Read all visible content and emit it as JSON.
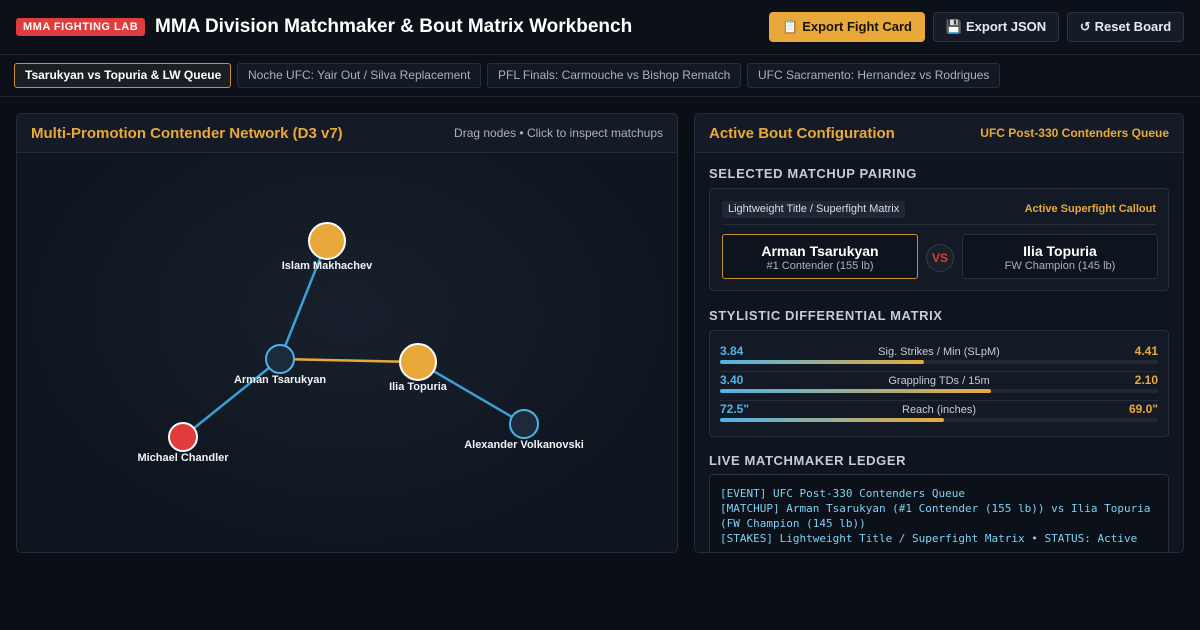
{
  "header": {
    "brand": "MMA FIGHTING LAB",
    "title": "MMA Division Matchmaker & Bout Matrix Workbench",
    "export_card_icon": "clipboard-icon",
    "export_card_glyph": "📋",
    "export_card": "Export Fight Card",
    "export_json_icon": "floppy-icon",
    "export_json_glyph": "💾",
    "export_json": "Export JSON",
    "reset_icon": "reset-icon",
    "reset_glyph": "↺",
    "reset": "Reset Board"
  },
  "tabs": [
    {
      "label": "Tsarukyan vs Topuria & LW Queue",
      "active": true
    },
    {
      "label": "Noche UFC: Yair Out / Silva Replacement",
      "active": false
    },
    {
      "label": "PFL Finals: Carmouche vs Bishop Rematch",
      "active": false
    },
    {
      "label": "UFC Sacramento: Hernandez vs Rodrigues",
      "active": false
    }
  ],
  "network": {
    "title": "Multi-Promotion Contender Network (D3 v7)",
    "hint": "Drag nodes • Click to inspect matchups",
    "nodes": [
      {
        "id": "makhachev",
        "label": "Islam Makhachev",
        "color": "#e8a93a",
        "stroke": "#ffffff",
        "big": true
      },
      {
        "id": "tsarukyan",
        "label": "Arman Tsarukyan",
        "color": "#1d2a3b",
        "stroke": "#4fb3e8",
        "big": false
      },
      {
        "id": "topuria",
        "label": "Ilia Topuria",
        "color": "#e8a93a",
        "stroke": "#ffffff",
        "big": true
      },
      {
        "id": "chandler",
        "label": "Michael Chandler",
        "color": "#e03c3c",
        "stroke": "#ffffff",
        "big": false
      },
      {
        "id": "volkanovski",
        "label": "Alexander Volkanovski",
        "color": "#1d2a3b",
        "stroke": "#4fb3e8",
        "big": false
      }
    ],
    "links": [
      {
        "source": "makhachev",
        "target": "tsarukyan",
        "color": "#3a9fd6"
      },
      {
        "source": "tsarukyan",
        "target": "topuria",
        "color": "#e8a93a"
      },
      {
        "source": "tsarukyan",
        "target": "chandler",
        "color": "#3a9fd6"
      },
      {
        "source": "topuria",
        "target": "volkanovski",
        "color": "#3a9fd6"
      }
    ]
  },
  "config": {
    "title": "Active Bout Configuration",
    "queue": "UFC Post-330 Contenders Queue",
    "pairing_heading": "Selected Matchup Pairing",
    "pairing_tag": "Lightweight Title / Superfight Matrix",
    "pairing_status": "Active Superfight Callout",
    "fighter_a": {
      "name": "Arman Tsarukyan",
      "sub": "#1 Contender (155 lb)"
    },
    "vs": "VS",
    "fighter_b": {
      "name": "Ilia Topuria",
      "sub": "FW Champion (145 lb)"
    },
    "matrix_heading": "Stylistic Differential Matrix",
    "stats": [
      {
        "a": "3.84",
        "label": "Sig. Strikes / Min (SLpM)",
        "b": "4.41",
        "fill": 0.465
      },
      {
        "a": "3.40",
        "label": "Grappling TDs / 15m",
        "b": "2.10",
        "fill": 0.618
      },
      {
        "a": "72.5\"",
        "label": "Reach (inches)",
        "b": "69.0\"",
        "fill": 0.512
      }
    ],
    "ledger_heading": "Live Matchmaker Ledger",
    "ledger": [
      "[EVENT] UFC Post-330 Contenders Queue",
      "[MATCHUP] Arman Tsarukyan (#1 Contender (155 lb)) vs Ilia Topuria",
      "(FW Champion (145 lb))",
      "[STAKES] Lightweight Title / Superfight Matrix • STATUS: Active"
    ]
  }
}
